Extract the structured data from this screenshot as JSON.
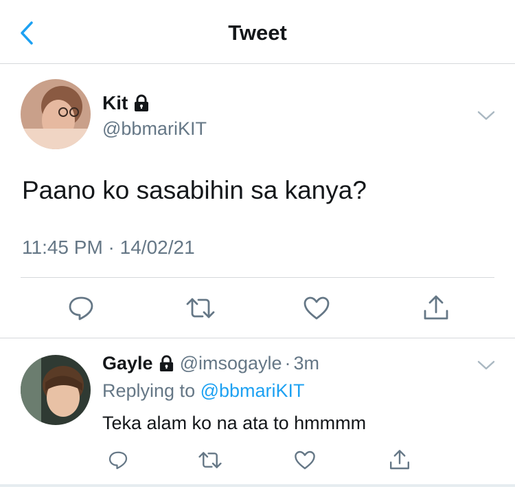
{
  "header": {
    "title": "Tweet"
  },
  "tweet": {
    "author_name": "Kit",
    "handle": "@bbmariKIT",
    "text": "Paano ko sasabihin sa kanya?",
    "timestamp": "11:45 PM · 14/02/21"
  },
  "reply": {
    "author_name": "Gayle",
    "handle": "@imsogayle",
    "separator": "·",
    "time": "3m",
    "replying_prefix": "Replying to",
    "replying_mention": "@bbmariKIT",
    "text": "Teka alam ko na ata to hmmmm"
  },
  "icons": {
    "back": "chevron-left-icon",
    "lock": "lock-icon",
    "more": "chevron-down-icon",
    "reply": "comment-icon",
    "retweet": "retweet-icon",
    "like": "heart-icon",
    "share": "share-icon"
  },
  "colors": {
    "accent": "#1da1f2",
    "text": "#14171a",
    "secondary": "#657786",
    "divider": "#d5d8db"
  }
}
